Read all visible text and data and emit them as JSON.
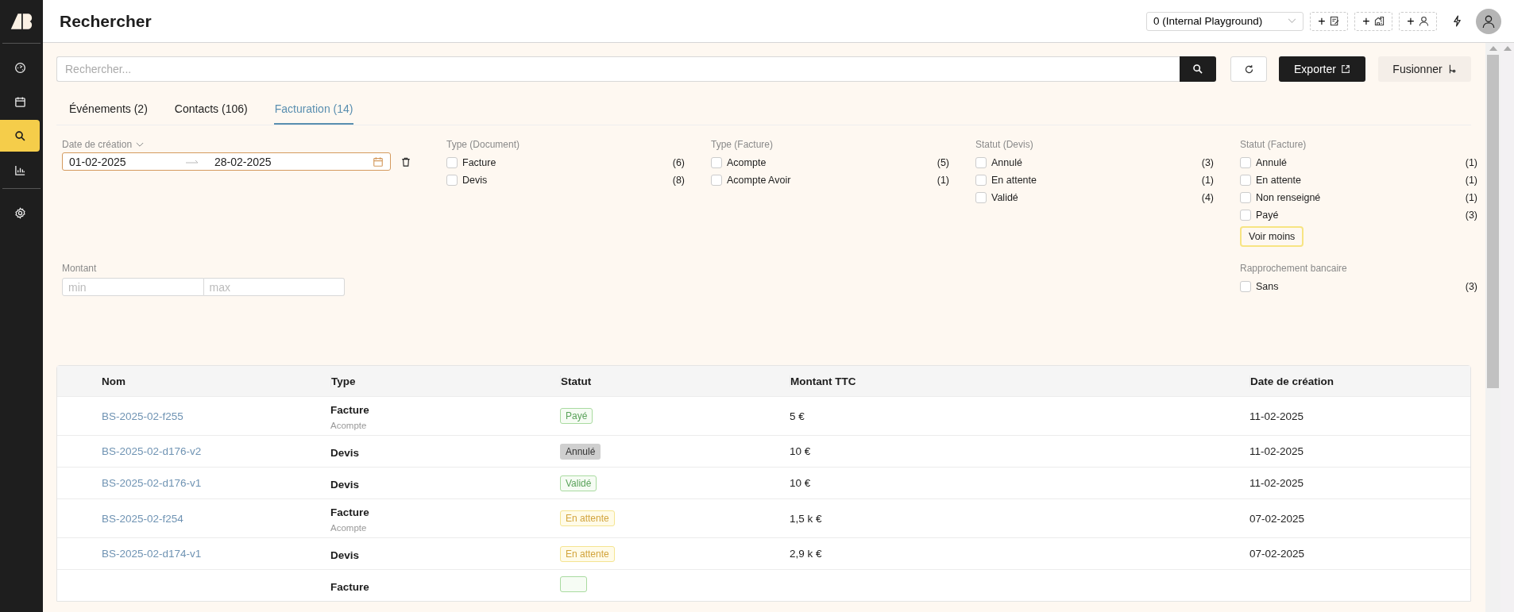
{
  "sidebar": {
    "main": [
      {
        "kind": "dashboard",
        "selected": false
      },
      {
        "kind": "calendar",
        "selected": false
      },
      {
        "kind": "search",
        "selected": true
      },
      {
        "kind": "chart",
        "selected": false
      }
    ],
    "bottom": [
      {
        "kind": "settings",
        "selected": false
      }
    ]
  },
  "header": {
    "title": "Rechercher",
    "organisation": "0 (Internal Playground)",
    "quick_add": [
      {
        "plus": "+",
        "kind": "document"
      },
      {
        "plus": "+",
        "kind": "building"
      },
      {
        "plus": "+",
        "kind": "person"
      }
    ]
  },
  "search": {
    "placeholder": "Rechercher...",
    "export": "Exporter",
    "merge": "Fusionner"
  },
  "tabs": [
    {
      "label": "Événements (2)",
      "selected": false
    },
    {
      "label": "Contacts (106)",
      "selected": false
    },
    {
      "label": "Facturation (14)",
      "selected": true
    }
  ],
  "filters": {
    "date": {
      "label": "Date de création",
      "from": "01-02-2025",
      "to": "28-02-2025"
    },
    "groups": [
      {
        "title": "Type (Document)",
        "options": [
          {
            "label": "Facture",
            "count": "(6)",
            "checked": false
          },
          {
            "label": "Devis",
            "count": "(8)",
            "checked": false
          }
        ]
      },
      {
        "title": "Type (Facture)",
        "options": [
          {
            "label": "Acompte",
            "count": "(5)",
            "checked": false
          },
          {
            "label": "Acompte Avoir",
            "count": "(1)",
            "checked": false
          }
        ]
      },
      {
        "title": "Statut (Devis)",
        "options": [
          {
            "label": "Annulé",
            "count": "(3)",
            "checked": false
          },
          {
            "label": "En attente",
            "count": "(1)",
            "checked": false
          },
          {
            "label": "Validé",
            "count": "(4)",
            "checked": false
          }
        ]
      },
      {
        "title": "Statut (Facture)",
        "options": [
          {
            "label": "Annulé",
            "count": "(1)",
            "checked": false
          },
          {
            "label": "En attente",
            "count": "(1)",
            "checked": false
          },
          {
            "label": "Non renseigné",
            "count": "(1)",
            "checked": false
          },
          {
            "label": "Payé",
            "count": "(3)",
            "checked": false
          }
        ],
        "toggle": "Voir moins"
      }
    ],
    "amount": {
      "label": "Montant",
      "min_placeholder": "min",
      "max_placeholder": "max"
    },
    "bank": {
      "title": "Rapprochement bancaire",
      "options": [
        {
          "label": "Sans",
          "count": "(3)",
          "checked": false
        }
      ]
    }
  },
  "table": {
    "columns": [
      "Nom",
      "Type",
      "Statut",
      "Montant TTC",
      "Date de création"
    ],
    "rows": [
      {
        "name": "BS-2025-02-f255",
        "type": "Facture",
        "subtype": "Acompte",
        "status": {
          "label": "Payé",
          "kind": "paid"
        },
        "amount": "5 €",
        "date": "11-02-2025"
      },
      {
        "name": "BS-2025-02-d176-v2",
        "type": "Devis",
        "status": {
          "label": "Annulé",
          "kind": "cancelled"
        },
        "amount": "10 €",
        "date": "11-02-2025"
      },
      {
        "name": "BS-2025-02-d176-v1",
        "type": "Devis",
        "status": {
          "label": "Validé",
          "kind": "validated"
        },
        "amount": "10 €",
        "date": "11-02-2025"
      },
      {
        "name": "BS-2025-02-f254",
        "type": "Facture",
        "subtype": "Acompte",
        "status": {
          "label": "En attente",
          "kind": "pending"
        },
        "amount": "1,5 k €",
        "date": "07-02-2025"
      },
      {
        "name": "BS-2025-02-d174-v1",
        "type": "Devis",
        "status": {
          "label": "En attente",
          "kind": "pending"
        },
        "amount": "2,9 k €",
        "date": "07-02-2025"
      },
      {
        "type": "Facture",
        "status": {
          "kind": "paid"
        }
      }
    ]
  }
}
